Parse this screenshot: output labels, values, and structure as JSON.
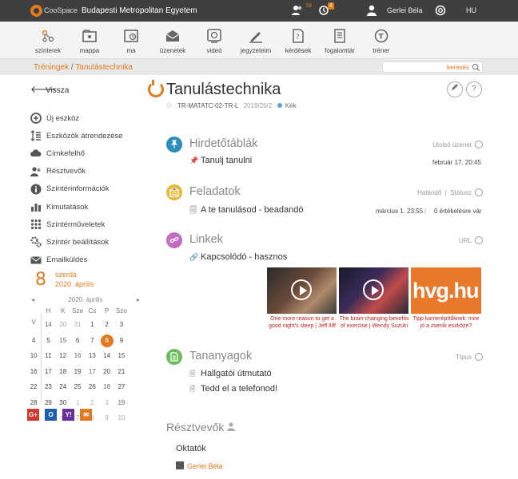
{
  "topbar": {
    "brand": "CooSpace",
    "institution": "Budapesti Metropolitan Egyetem",
    "users_badge": "18",
    "clock_badge": "4",
    "user_name": "Gerlei Béla",
    "language": "HU"
  },
  "nav": [
    {
      "label": "színterek",
      "icon": "network-icon"
    },
    {
      "label": "mappa",
      "icon": "folder-icon"
    },
    {
      "label": "ma",
      "icon": "clock-icon"
    },
    {
      "label": "üzenetek",
      "icon": "envelope-icon"
    },
    {
      "label": "videó",
      "icon": "video-icon"
    },
    {
      "label": "jegyzeteim",
      "icon": "pen-icon"
    },
    {
      "label": "kérdések",
      "icon": "question-doc-icon"
    },
    {
      "label": "fogalomtár",
      "icon": "book-icon"
    },
    {
      "label": "tréner",
      "icon": "trainer-icon"
    }
  ],
  "breadcrumb": {
    "part1": "Tréningek",
    "separator": "/",
    "part2": "Tanulástechnika"
  },
  "search": {
    "placeholder": "keresés"
  },
  "sidebar": {
    "back_label": "Vissza",
    "items": [
      {
        "label": "Új eszköz",
        "icon": "add-icon"
      },
      {
        "label": "Eszközök átrendezése",
        "icon": "reorder-icon"
      },
      {
        "label": "Címkefelhő",
        "icon": "cloud-icon"
      },
      {
        "label": "Résztvevők",
        "icon": "participants-icon"
      },
      {
        "label": "Színtérinformációk",
        "icon": "info-icon"
      },
      {
        "label": "Kimutatások",
        "icon": "stats-icon"
      },
      {
        "label": "Színtérműveletek",
        "icon": "grid-icon"
      },
      {
        "label": "Színtér beállítások",
        "icon": "settings-icon"
      },
      {
        "label": "Emailküldés",
        "icon": "email-icon"
      }
    ]
  },
  "date": {
    "day_number": "8",
    "weekday": "szerda",
    "month": "2020. április"
  },
  "calendar": {
    "month_label": "2020. április",
    "prev": "◂",
    "next": "▸",
    "weekdays": [
      "",
      "H",
      "K",
      "Sze",
      "Cs",
      "P",
      "Szo",
      "V"
    ],
    "weeks": [
      [
        "14",
        "30",
        "31",
        "1",
        "2",
        "3",
        "4",
        "5"
      ],
      [
        "15",
        "6",
        "7",
        "8",
        "9",
        "10",
        "11",
        "12"
      ],
      [
        "16",
        "13",
        "14",
        "15",
        "16",
        "17",
        "18",
        "19"
      ],
      [
        "17",
        "20",
        "21",
        "22",
        "23",
        "24",
        "25",
        "26"
      ],
      [
        "18",
        "27",
        "28",
        "29",
        "30",
        "1",
        "2",
        "3"
      ],
      [
        "19",
        "4",
        "5",
        "6",
        "7",
        "8",
        "9",
        "10"
      ]
    ]
  },
  "course": {
    "title": "Tanulástechnika",
    "code": "TR-MATATC-02-TR-L",
    "term": "2019/20/2",
    "tag": "Kék"
  },
  "sections": {
    "hirdeto": {
      "title": "Hirdetőtáblák",
      "right": "Utolsó üzenet",
      "item": "Tanulj tanulni",
      "item_date": "február 17. 20:45"
    },
    "feladatok": {
      "title": "Feladatok",
      "right1": "Határidő",
      "right2": "Státusz",
      "item": "A te tanulásod - beadandó",
      "item_date": "március 1. 23:55",
      "item_status": "0 értékelésre vár"
    },
    "linkek": {
      "title": "Linkek",
      "right": "URL",
      "item": "Kapcsolódó - hasznos"
    },
    "tananyagok": {
      "title": "Tananyagok",
      "right": "Típus",
      "items": [
        "Hallgatói útmutató",
        "Tedd el a telefonod!"
      ]
    }
  },
  "thumbs": [
    {
      "caption": "One more reason to get a good night's sleep | Jeff Iliff"
    },
    {
      "caption": "The brain-changing benefits of exercise | Wendy Suzuki"
    },
    {
      "caption": "Tipp karrierépítőknek: mire jó a zsenik eszköze?",
      "logo_text": "hvg.hu"
    }
  ],
  "participants": {
    "title": "Résztvevők",
    "group": "Oktatók",
    "teacher": "Gerlei Béla"
  },
  "apps": [
    "G+",
    "O",
    "Y!",
    "✉"
  ]
}
